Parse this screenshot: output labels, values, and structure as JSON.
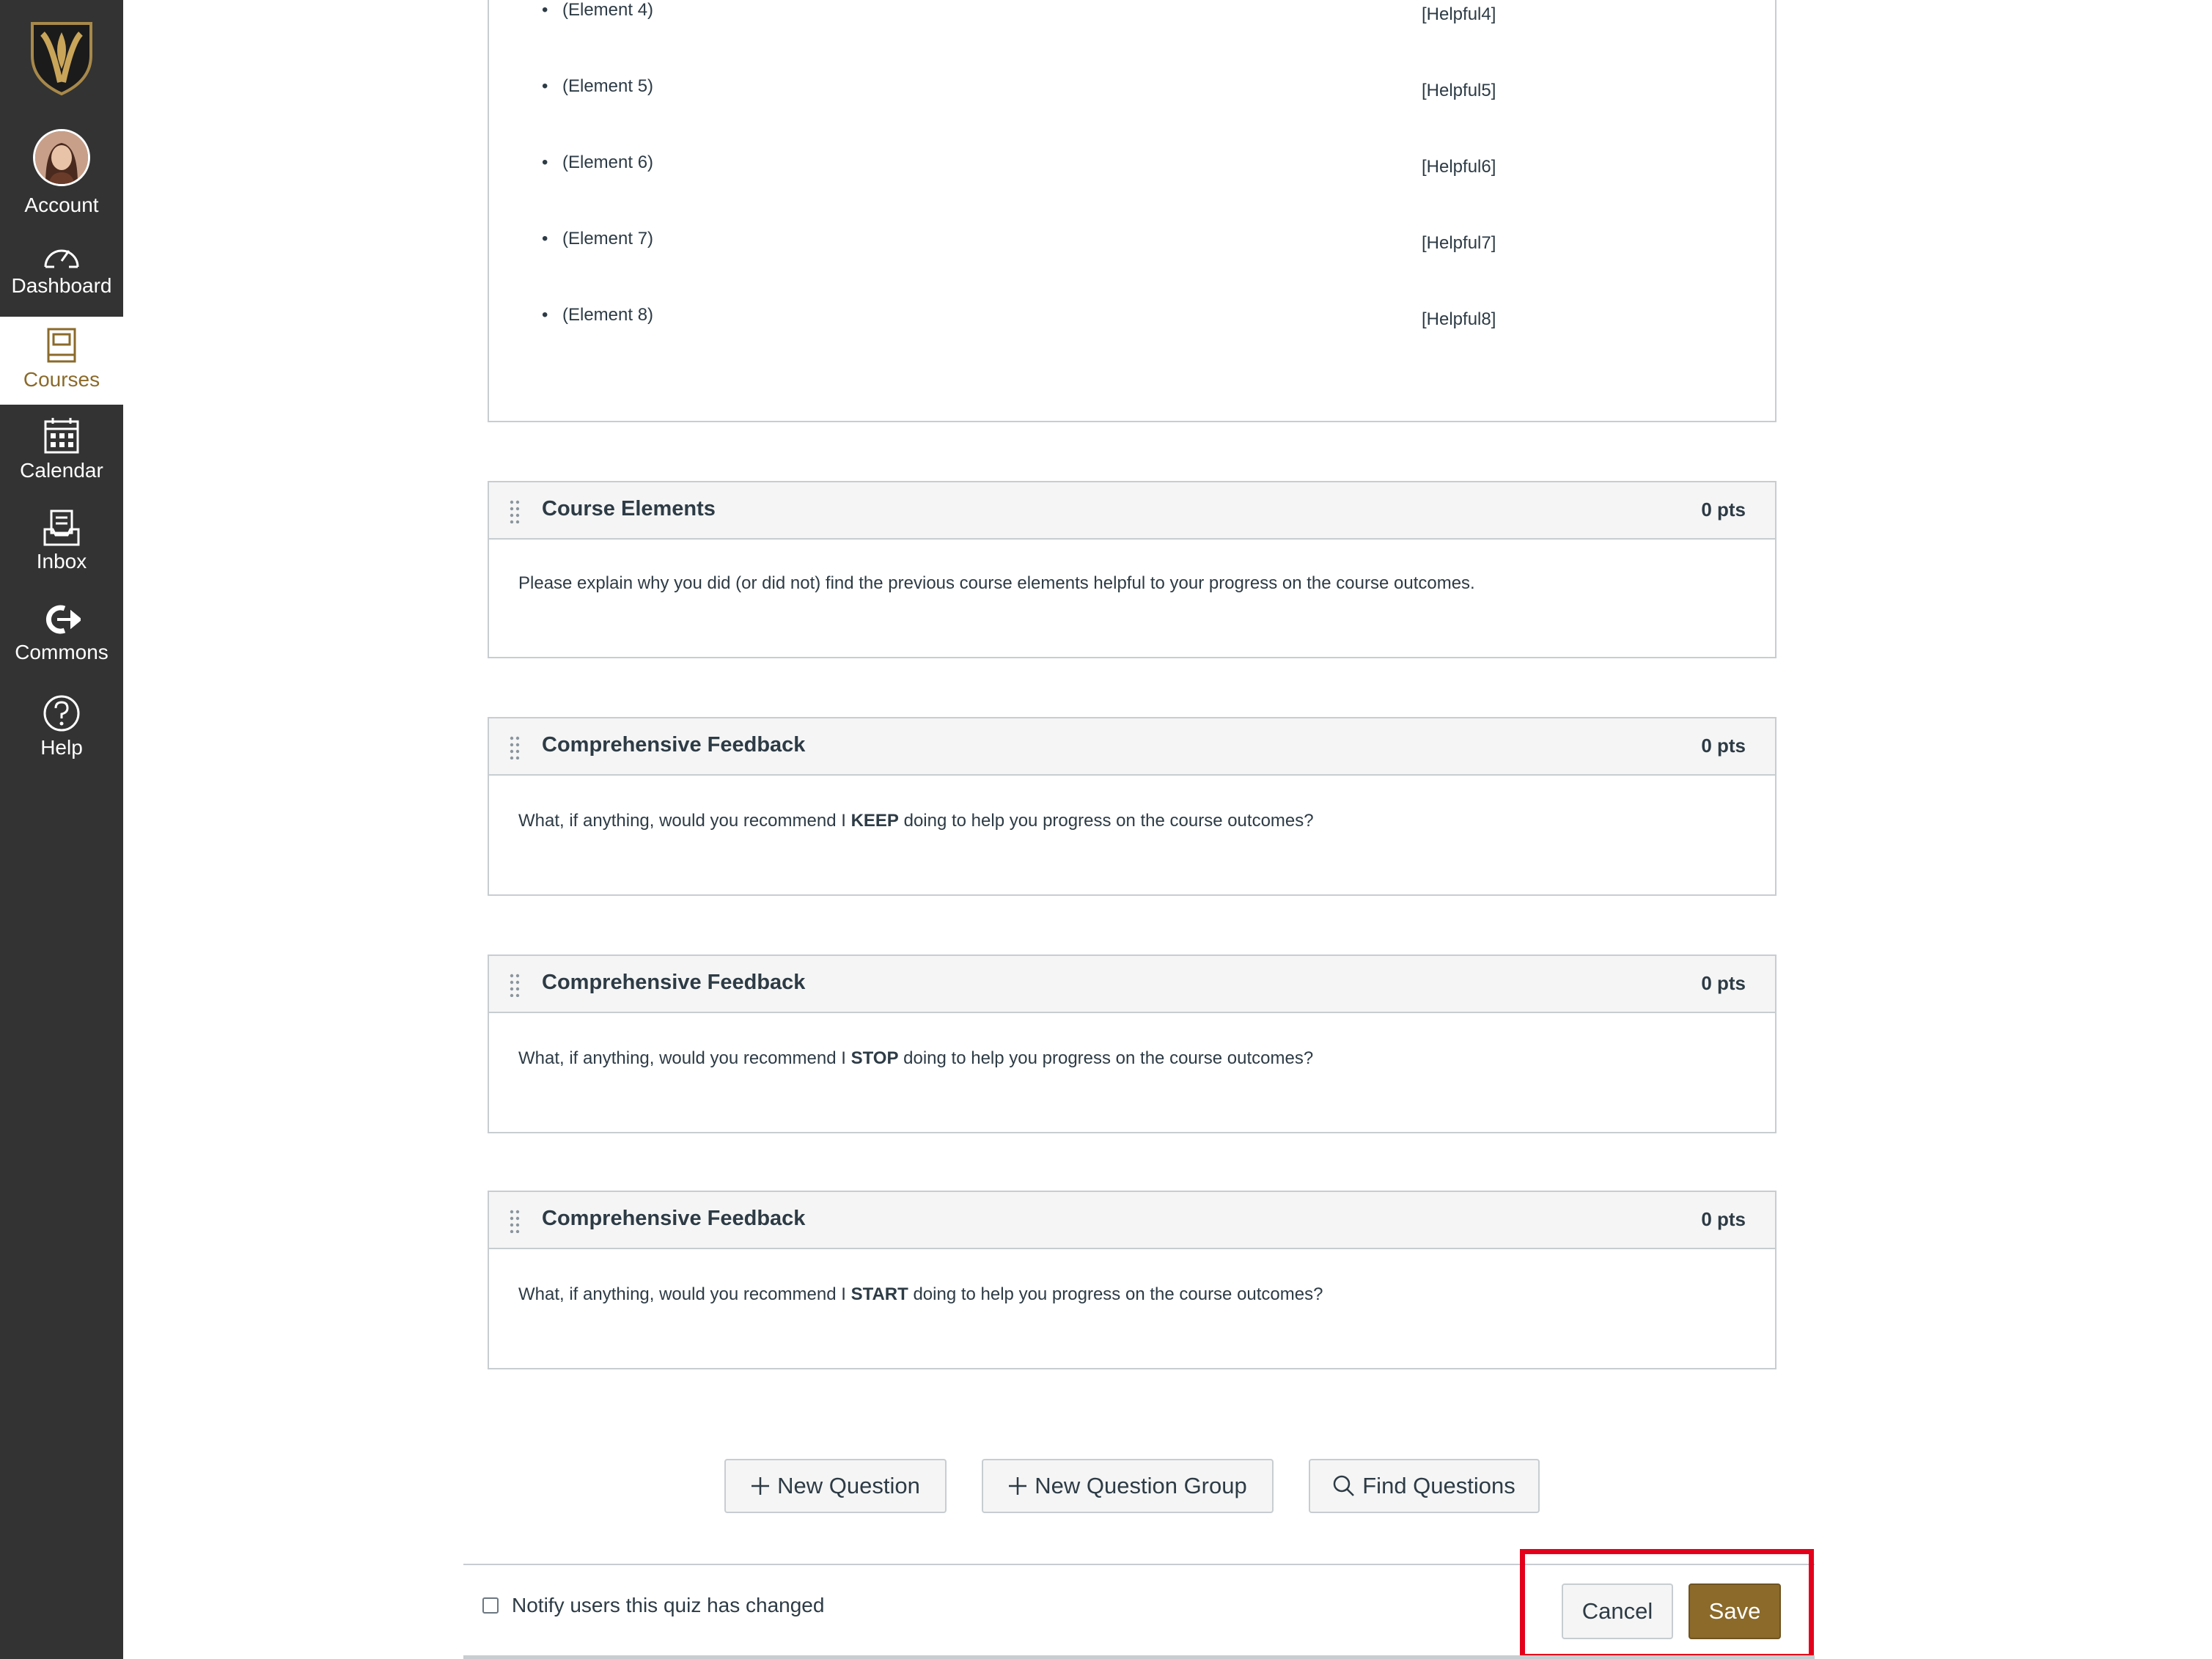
{
  "nav": {
    "items": [
      {
        "label": "Account"
      },
      {
        "label": "Dashboard"
      },
      {
        "label": "Courses"
      },
      {
        "label": "Calendar"
      },
      {
        "label": "Inbox"
      },
      {
        "label": "Commons"
      },
      {
        "label": "Help"
      }
    ],
    "active": "Courses"
  },
  "elements_list": [
    {
      "label": "(Element 4)",
      "tag": "[Helpful4]"
    },
    {
      "label": "(Element 5)",
      "tag": "[Helpful5]"
    },
    {
      "label": "(Element 6)",
      "tag": "[Helpful6]"
    },
    {
      "label": "(Element 7)",
      "tag": "[Helpful7]"
    },
    {
      "label": "(Element 8)",
      "tag": "[Helpful8]"
    }
  ],
  "questions": [
    {
      "title": "Course Elements",
      "points": "0 pts",
      "text_before": "Please explain why you did (or did not) find the previous course elements helpful to your progress on the course outcomes.",
      "bold": "",
      "text_after": ""
    },
    {
      "title": "Comprehensive Feedback",
      "points": "0 pts",
      "text_before": "What, if anything, would you recommend I ",
      "bold": "KEEP",
      "text_after": " doing to help you progress on the course outcomes?"
    },
    {
      "title": "Comprehensive Feedback",
      "points": "0 pts",
      "text_before": "What, if anything, would you recommend I ",
      "bold": "STOP",
      "text_after": " doing to help you progress on the course outcomes?"
    },
    {
      "title": "Comprehensive Feedback",
      "points": "0 pts",
      "text_before": "What, if anything, would you recommend I ",
      "bold": "START",
      "text_after": " doing to help you progress on the course outcomes?"
    }
  ],
  "actions": {
    "new_question": "New Question",
    "new_question_group": "New Question Group",
    "find_questions": "Find Questions"
  },
  "footer": {
    "notify_label": "Notify users this quiz has changed",
    "notify_checked": false,
    "cancel": "Cancel",
    "save": "Save"
  },
  "colors": {
    "sidebar": "#333333",
    "brand_gold": "#8b6a2a",
    "highlight": "#e3001b"
  }
}
